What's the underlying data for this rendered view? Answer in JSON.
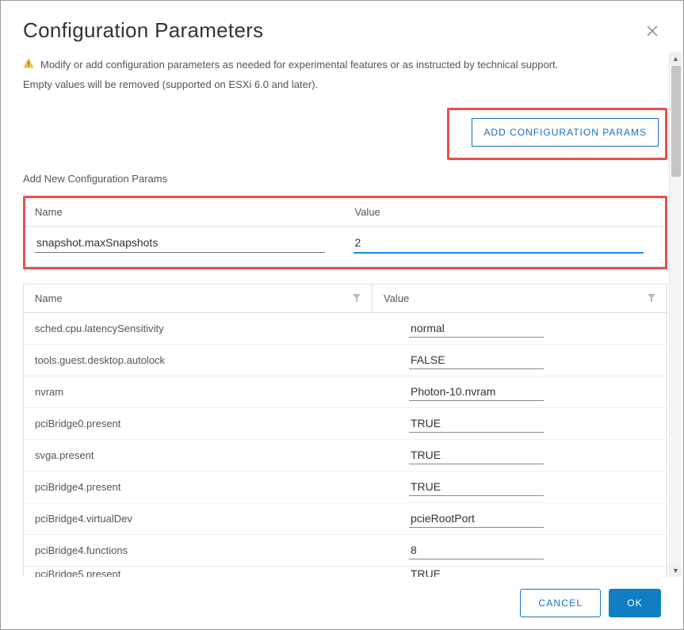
{
  "dialog": {
    "title": "Configuration Parameters",
    "warning": "Modify or add configuration parameters as needed for experimental features or as instructed by technical support.",
    "subnote": "Empty values will be removed (supported on ESXi 6.0 and later).",
    "add_button": "ADD CONFIGURATION PARAMS",
    "section_label": "Add New Configuration Params",
    "new_param_header_name": "Name",
    "new_param_header_value": "Value",
    "new_param_name_value": "snapshot.maxSnapshots",
    "new_param_value_value": "2",
    "table": {
      "col_name": "Name",
      "col_value": "Value",
      "rows": [
        {
          "name": "sched.cpu.latencySensitivity",
          "value": "normal"
        },
        {
          "name": "tools.guest.desktop.autolock",
          "value": "FALSE"
        },
        {
          "name": "nvram",
          "value": "Photon-10.nvram"
        },
        {
          "name": "pciBridge0.present",
          "value": "TRUE"
        },
        {
          "name": "svga.present",
          "value": "TRUE"
        },
        {
          "name": "pciBridge4.present",
          "value": "TRUE"
        },
        {
          "name": "pciBridge4.virtualDev",
          "value": "pcieRootPort"
        },
        {
          "name": "pciBridge4.functions",
          "value": "8"
        },
        {
          "name": "pciBridge5.present",
          "value": "TRUE"
        }
      ]
    },
    "cancel": "CANCEL",
    "ok": "OK"
  }
}
